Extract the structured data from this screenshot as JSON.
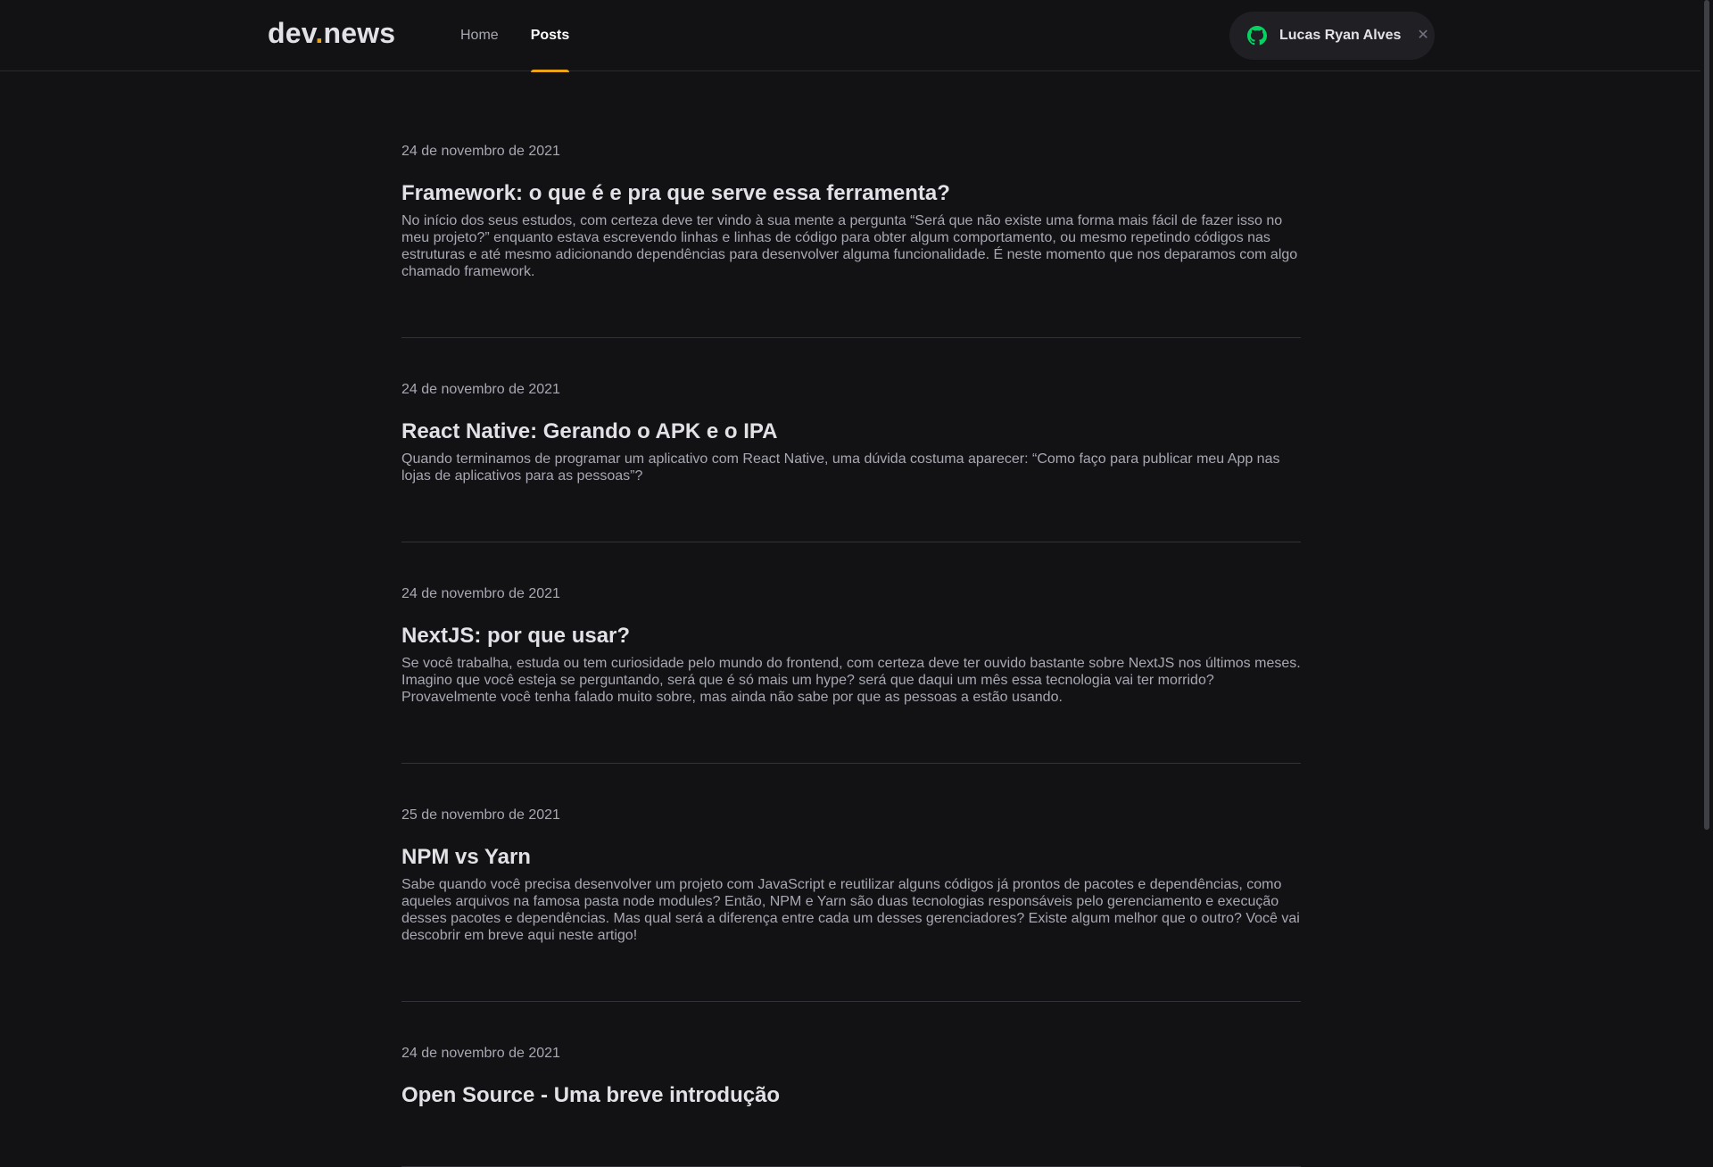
{
  "header": {
    "logo_main": "dev",
    "logo_dot": ".",
    "logo_suffix": "news",
    "nav": [
      {
        "label": "Home",
        "active": false
      },
      {
        "label": "Posts",
        "active": true
      }
    ],
    "user": {
      "name": "Lucas Ryan Alves",
      "icon": "github-icon",
      "close_icon": "close-icon"
    }
  },
  "colors": {
    "background": "#121214",
    "accent": "#eba417",
    "github_icon": "#04d361",
    "text": "#e1e1e6",
    "muted": "#a8a8b3"
  },
  "posts": [
    {
      "date": "24 de novembro de 2021",
      "title": "Framework: o que é e pra que serve essa ferramenta?",
      "excerpt": "No início dos seus estudos, com certeza deve ter vindo à sua mente a pergunta “Será que não existe uma forma mais fácil de fazer isso no meu projeto?” enquanto estava escrevendo linhas e linhas de código para obter algum comportamento, ou mesmo repetindo códigos nas estruturas e até mesmo adicionando dependências para desenvolver alguma funcionalidade. É neste momento que nos deparamos com algo chamado framework."
    },
    {
      "date": "24 de novembro de 2021",
      "title": "React Native: Gerando o APK e o IPA",
      "excerpt": "Quando terminamos de programar um aplicativo com React Native, uma dúvida costuma aparecer: “Como faço para publicar meu App nas lojas de aplicativos para as pessoas”?"
    },
    {
      "date": "24 de novembro de 2021",
      "title": "NextJS: por que usar?",
      "excerpt": "Se você trabalha, estuda ou tem curiosidade pelo mundo do frontend, com certeza deve ter ouvido bastante sobre NextJS nos últimos meses. Imagino que você esteja se perguntando, será que é só mais um hype? será que daqui um mês essa tecnologia vai ter morrido? Provavelmente você tenha falado muito sobre, mas ainda não sabe por que as pessoas a estão usando."
    },
    {
      "date": "25 de novembro de 2021",
      "title": "NPM vs Yarn",
      "excerpt": "Sabe quando você precisa desenvolver um projeto com JavaScript e reutilizar alguns códigos já prontos de pacotes e dependências, como aqueles arquivos na famosa pasta node modules? Então, NPM e Yarn são duas tecnologias responsáveis pelo gerenciamento e execução desses pacotes e dependências. Mas qual será a diferença entre cada um desses gerenciadores? Existe algum melhor que o outro? Você vai descobrir em breve aqui neste artigo!"
    },
    {
      "date": "24 de novembro de 2021",
      "title": "Open Source - Uma breve introdução",
      "excerpt": ""
    }
  ]
}
